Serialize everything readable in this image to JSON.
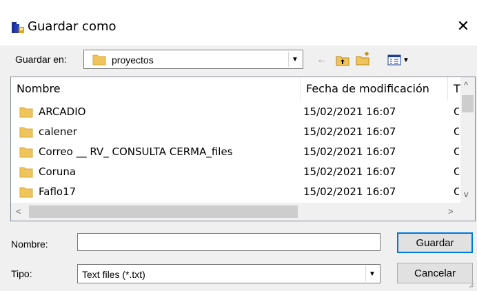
{
  "window": {
    "title": "Guardar como",
    "close_glyph": "✕"
  },
  "toolbar": {
    "save_in_label": "Guardar en:",
    "folder": "proyectos",
    "back_glyph": "←"
  },
  "columns": {
    "name": "Nombre",
    "date": "Fecha de modificación",
    "type": "T"
  },
  "files": [
    {
      "name": "ARCADIO",
      "date": "15/02/2021 16:07",
      "type": "C"
    },
    {
      "name": "calener",
      "date": "15/02/2021 16:07",
      "type": "C"
    },
    {
      "name": "Correo __ RV_ CONSULTA CERMA_files",
      "date": "15/02/2021 16:07",
      "type": "C"
    },
    {
      "name": "Coruna",
      "date": "15/02/2021 16:07",
      "type": "C"
    },
    {
      "name": "Faflo17",
      "date": "15/02/2021 16:07",
      "type": "C"
    }
  ],
  "form": {
    "name_label": "Nombre:",
    "name_value": "",
    "type_label": "Tipo:",
    "type_value": "Text files (*.txt)",
    "save_button": "Guardar",
    "cancel_button": "Cancelar"
  },
  "icons": {
    "app": "save-as-app-icon",
    "folder": "folder-icon",
    "up_folder": "up-folder-icon",
    "new_folder": "new-folder-icon",
    "view_menu": "view-menu-icon"
  },
  "colors": {
    "folder": "#f0c45a",
    "selection": "#0078d7"
  }
}
